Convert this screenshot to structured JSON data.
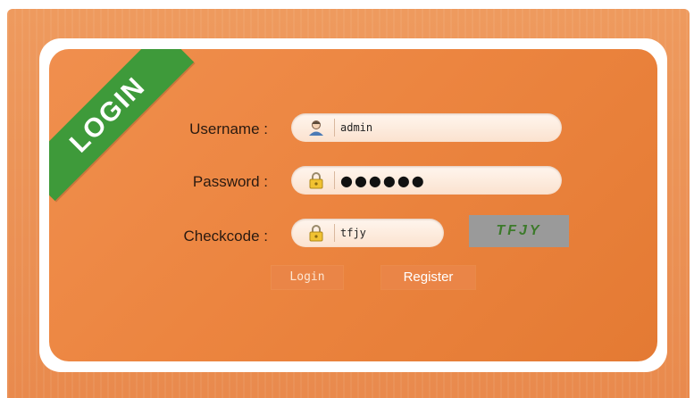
{
  "ribbon": {
    "text": "LOGIN"
  },
  "form": {
    "username_label": "Username :",
    "username_value": "admin",
    "password_label": "Password :",
    "password_value": "●●●●●●",
    "checkcode_label": "Checkcode :",
    "checkcode_value": "tfjy",
    "captcha_text": "TFJY"
  },
  "buttons": {
    "login": "Login",
    "register": "Register"
  },
  "colors": {
    "background": "#ec8540",
    "ribbon": "#3e9a3a",
    "captcha_bg": "#9a9a9a",
    "captcha_text": "#3c7a2a"
  },
  "icons": {
    "username": "user-icon",
    "password": "lock-icon",
    "checkcode": "lock-icon"
  }
}
